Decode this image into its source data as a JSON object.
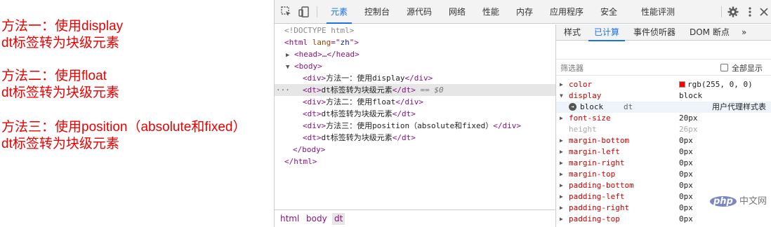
{
  "page": {
    "paragraphs": [
      {
        "line1": "方法一：使用display",
        "line2": "dt标签转为块级元素"
      },
      {
        "line1": "方法二：使用float",
        "line2": "dt标签转为块级元素"
      },
      {
        "line1": "方法三：使用position（absolute和fixed）",
        "line2": "dt标签转为块级元素"
      }
    ],
    "text_color": "#ee0000"
  },
  "devtools": {
    "toolbar": {
      "icons": [
        "inspect-element-icon",
        "device-toolbar-icon",
        "settings-gear-icon",
        "more-vertical-icon",
        "close-icon"
      ],
      "tabs": [
        "元素",
        "控制台",
        "源代码",
        "网络",
        "性能",
        "内存",
        "应用程序",
        "安全",
        "性能评测"
      ],
      "active_tab": "元素"
    },
    "elements": {
      "doctype": "<!DOCTYPE html>",
      "html_open_tag": "<html",
      "html_attr_name": "lang",
      "html_attr_eq": "=\"",
      "html_attr_value": "zh",
      "html_open_close": "\">",
      "head_collapsed": "<head>…</head>",
      "body_open": "<body>",
      "nodes": [
        {
          "open": "<div>",
          "text": "方法一：使用display",
          "close": "</div>"
        },
        {
          "open": "<dt>",
          "text": "dt标签转为块级元素",
          "close": "</dt>"
        },
        {
          "open": "<div>",
          "text": "方法二：使用float",
          "close": "</div>"
        },
        {
          "open": "<dt>",
          "text": "dt标签转为块级元素",
          "close": "</dt>"
        },
        {
          "open": "<div>",
          "text": "方法三：使用position（absolute和fixed）",
          "close": "</div>"
        },
        {
          "open": "<dt>",
          "text": "dt标签转为块级元素",
          "close": "</dt>"
        }
      ],
      "selected_marker": "== $0",
      "row_menu": "···",
      "body_close": "</body>",
      "html_close": "</html>"
    },
    "breadcrumbs": [
      "html",
      "body",
      "dt"
    ],
    "sidebar": {
      "tabs": [
        "样式",
        "已计算",
        "事件侦听器",
        "DOM 断点",
        "»"
      ],
      "active_tab": "已计算",
      "filter_label": "筛选器",
      "show_all_label": "全部显示",
      "show_all_checked": false,
      "properties": [
        {
          "name": "color",
          "value": "rgb(255, 0, 0)",
          "swatch": "#ff0000"
        },
        {
          "name": "display",
          "value": "block",
          "expanded": true
        },
        {
          "name": "font-size",
          "value": "20px"
        },
        {
          "name": "height",
          "value": "26px",
          "inherited": true
        },
        {
          "name": "margin-bottom",
          "value": "0px"
        },
        {
          "name": "margin-left",
          "value": "0px"
        },
        {
          "name": "margin-right",
          "value": "0px"
        },
        {
          "name": "margin-top",
          "value": "0px"
        },
        {
          "name": "padding-bottom",
          "value": "0px"
        },
        {
          "name": "padding-left",
          "value": "0px"
        },
        {
          "name": "padding-right",
          "value": "0px"
        },
        {
          "name": "padding-top",
          "value": "0px"
        }
      ],
      "display_trace": {
        "value": "block",
        "selector": "dt",
        "source": "用户代理样式表"
      }
    }
  },
  "watermark": {
    "logo": "php",
    "text": "中文网"
  }
}
